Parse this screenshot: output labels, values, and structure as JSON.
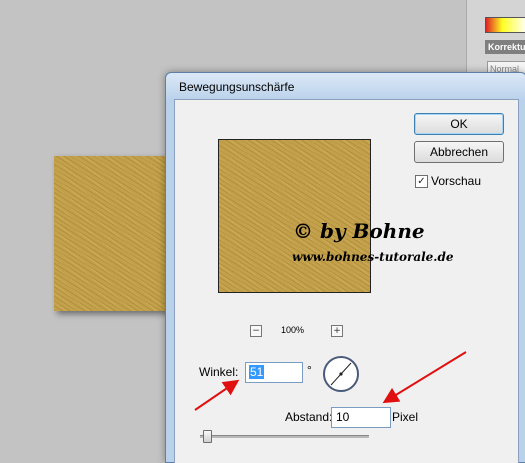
{
  "panel": {
    "header_label": "Korrektur",
    "blend_mode": "Normal"
  },
  "dialog": {
    "title": "Bewegungsunschärfe",
    "ok_label": "OK",
    "cancel_label": "Abbrechen",
    "preview_label": "Vorschau",
    "preview_checked": true,
    "zoom_minus": "−",
    "zoom_plus": "+",
    "zoom_level": "100%",
    "angle_label": "Winkel:",
    "angle_value": "51",
    "degree_symbol": "°",
    "distance_label": "Abstand:",
    "distance_value": "10",
    "distance_unit": "Pixel",
    "distance_slider_fraction": 0.02
  },
  "watermark": {
    "line1": "© by Bohne",
    "line2": "www.bohnes-tutorale.de"
  },
  "colors": {
    "accent_arrow": "#e01010",
    "texture": "#c3a04a",
    "dialog_frame": "#b9d1ea"
  }
}
